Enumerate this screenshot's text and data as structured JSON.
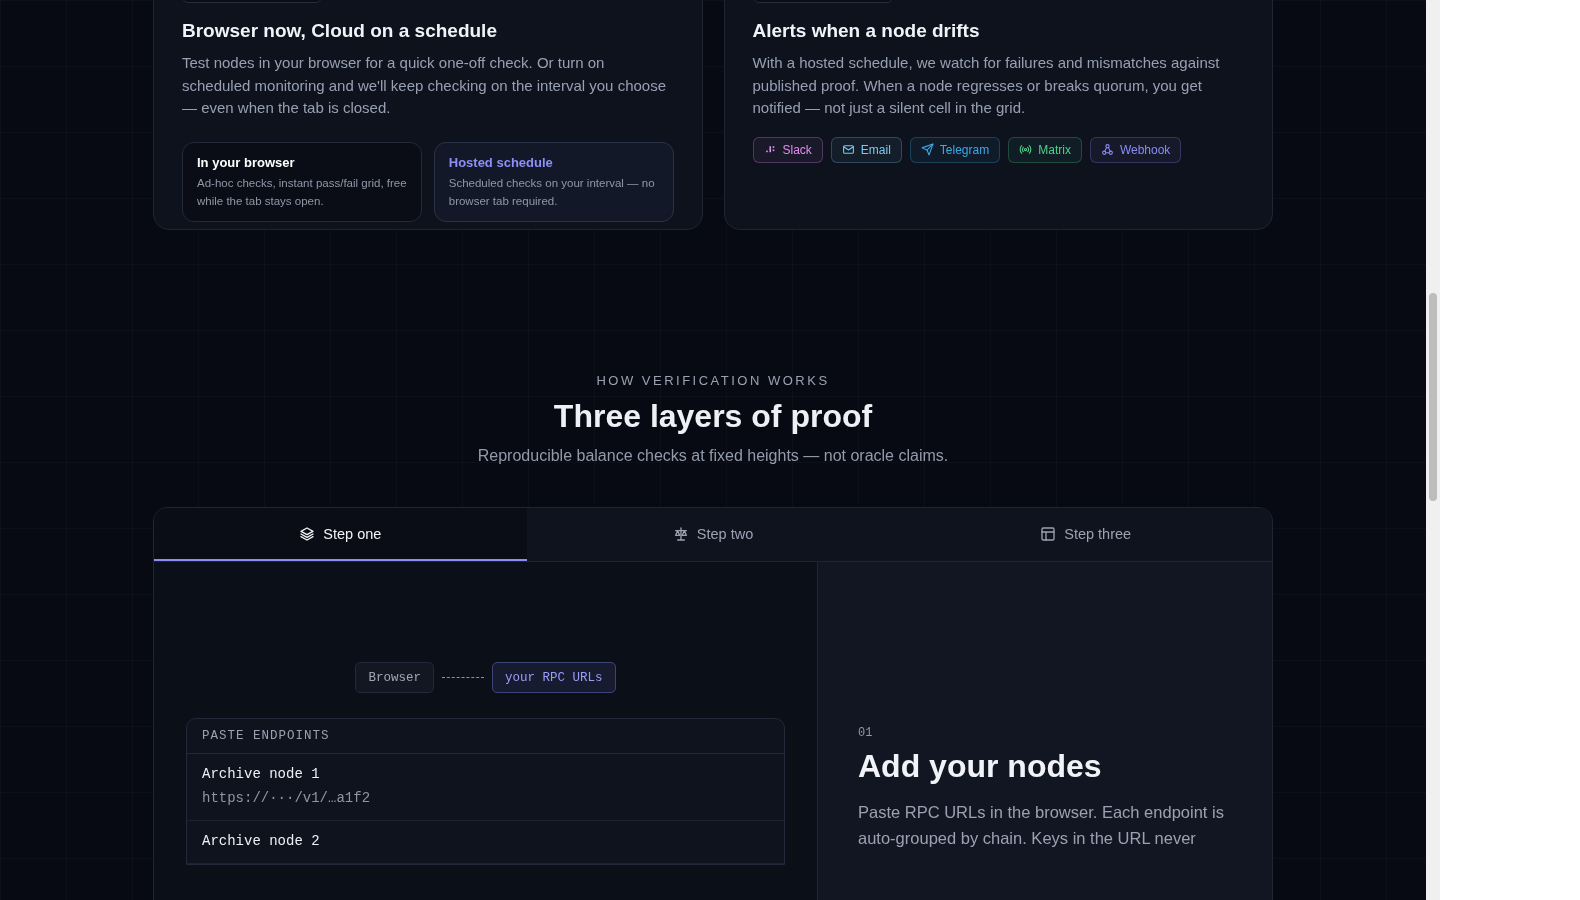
{
  "feature_cards": [
    {
      "title": "Browser now, Cloud on a schedule",
      "body": "Test nodes in your browser for a quick one-off check. Or turn on scheduled monitoring and we'll keep checking on the interval you choose — even when the tab is closed.",
      "options": [
        {
          "title": "In your browser",
          "description": "Ad-hoc checks, instant pass/fail grid, free while the tab stays open.",
          "selected": false
        },
        {
          "title": "Hosted schedule",
          "description": "Scheduled checks on your interval — no browser tab required.",
          "selected": true
        }
      ]
    },
    {
      "title": "Alerts when a node drifts",
      "body": "With a hosted schedule, we watch for failures and mismatches against published proof. When a node regresses or breaks quorum, you get notified — not just a silent cell in the grid.",
      "channels": [
        {
          "label": "Slack",
          "color": "#e28ef0"
        },
        {
          "label": "Email",
          "color": "#7cc8f0"
        },
        {
          "label": "Telegram",
          "color": "#3ea9e6"
        },
        {
          "label": "Matrix",
          "color": "#4fd08a"
        },
        {
          "label": "Webhook",
          "color": "#8b8cf5"
        }
      ]
    }
  ],
  "section": {
    "eyebrow": "HOW VERIFICATION WORKS",
    "title": "Three layers of proof",
    "subtitle": "Reproducible balance checks at fixed heights — not oracle claims."
  },
  "steps": {
    "tabs": [
      {
        "label": "Step one",
        "selected": true
      },
      {
        "label": "Step two",
        "selected": false
      },
      {
        "label": "Step three",
        "selected": false
      }
    ],
    "diagram": {
      "nodes": [
        {
          "label": "Browser",
          "selected": false
        },
        {
          "label": "your RPC URLs",
          "selected": true
        }
      ]
    },
    "endpoints": {
      "header": "PASTE ENDPOINTS",
      "rows": [
        {
          "name": "Archive node 1",
          "url": "https://···/v1/…a1f2"
        },
        {
          "name": "Archive node 2"
        }
      ]
    },
    "detail": {
      "number": "01",
      "title": "Add your nodes",
      "body": "Paste RPC URLs in the browser. Each endpoint is auto-grouped by chain. Keys in the URL never"
    }
  }
}
